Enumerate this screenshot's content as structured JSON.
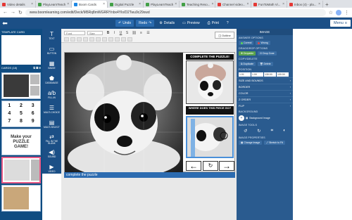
{
  "browser": {
    "tabs": [
      {
        "label": "Video details",
        "color": "#e53935"
      },
      {
        "label": "PlayLearnTeach",
        "color": "#43a047"
      },
      {
        "label": "Boom Cards",
        "color": "#1e88e5",
        "active": true
      },
      {
        "label": "Digital Puzzle",
        "color": "#43a047"
      },
      {
        "label": "PlayLearnTeach",
        "color": "#43a047"
      },
      {
        "label": "Teaching Reso...",
        "color": "#43a047"
      },
      {
        "label": "Channel video...",
        "color": "#e53935"
      },
      {
        "label": "FunToMath Vi...",
        "color": "#e53935"
      },
      {
        "label": "Inbox (4) - pla...",
        "color": "#e53935"
      }
    ],
    "url": "www.boomlearning.com/edit/Deck/M5Rq8mWGRRYnbx4Ylo/D2Twu9c29xwd"
  },
  "header": {
    "undo": "Undo",
    "redo": "Redo",
    "details": "Details",
    "preview": "Preview",
    "print": "Print",
    "menu": "Menu"
  },
  "left": {
    "template_label": "TEMPLATE CARD",
    "cards_label": "CARDS (18)",
    "make_text": "Make your PUZZLE GAME!",
    "numbers": [
      "1",
      "2",
      "3",
      "4",
      "5",
      "6",
      "7",
      "8",
      "9"
    ]
  },
  "tools": [
    {
      "icon": "T",
      "label": "TEXT"
    },
    {
      "icon": "▭",
      "label": "BUTTON"
    },
    {
      "icon": "▦",
      "label": "IMAGE"
    },
    {
      "icon": "⬟",
      "label": "DATAIMAGE"
    },
    {
      "icon": "a/b",
      "label": "FILL-IN"
    },
    {
      "icon": "☰",
      "label": "MULTI-CHOICE"
    },
    {
      "icon": "▤",
      "label": "MULTI-SELECT"
    },
    {
      "icon": "⇄",
      "label": "FILL IN THE BLANK"
    },
    {
      "icon": "◀)",
      "label": "SOUND"
    },
    {
      "icon": "▶",
      "label": "VIDEO"
    }
  ],
  "editor": {
    "font_placeholder": "Font",
    "size_placeholder": "Size",
    "outline": "Outline",
    "title": "COMPLETE THE PUZZLE!",
    "question": "WHERE DOES THIS PIECE GO?",
    "caption": "complete the puzzle"
  },
  "right": {
    "title": "IMAGE",
    "answer_options": "ANSWER OPTIONS",
    "correct": "Correct",
    "wrong": "Wrong",
    "drag_drop": "DRAG/DROP OPTIONS",
    "dropable": "Dropable",
    "drop_zone": "Drop Zone",
    "copy_delete": "COPY/DELETE",
    "duplicate": "Duplicate",
    "delete": "Delete",
    "position": "POSITION",
    "pos_values": [
      "1.01",
      "1.00",
      "130.00",
      "100.00"
    ],
    "size_bounds": "SIZE AND BOUNDS",
    "border_label": "BORDER",
    "color": "COLOR",
    "z_order": "Z ORDER",
    "flip": "FLIP",
    "background": "BACKGROUND",
    "background_image": "Background Image",
    "image_tools": "IMAGE TOOLS",
    "image_properties": "IMAGE PROPERTIES",
    "change_image": "Change Image",
    "stretch": "Stretch to Fit"
  }
}
